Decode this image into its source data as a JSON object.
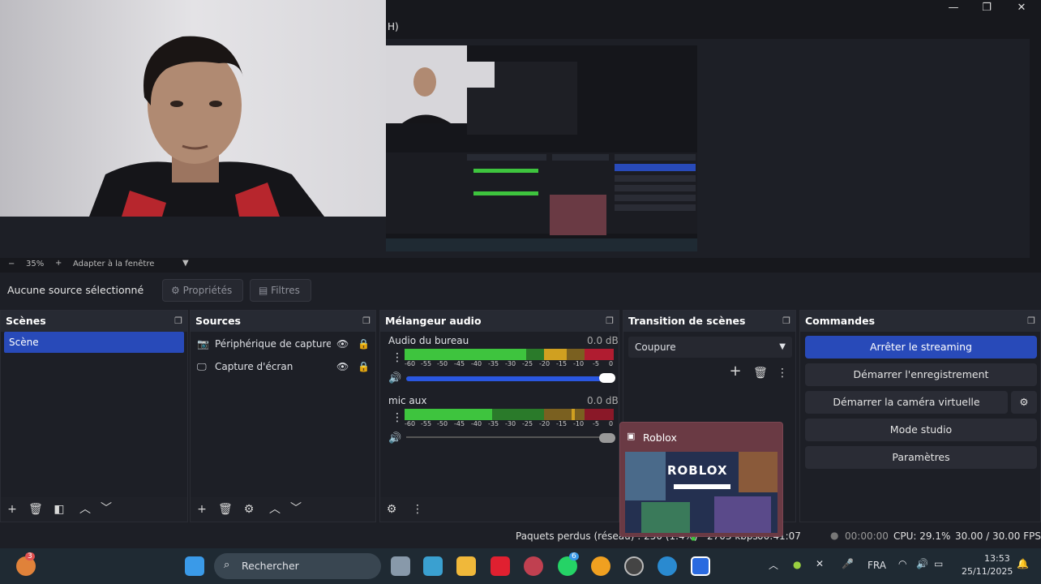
{
  "titlebar": {
    "menu_partial": "H)",
    "minimize": "—",
    "maximize": "❐",
    "close": "✕"
  },
  "zoom": {
    "minus": "−",
    "value": "35%",
    "plus": "+",
    "fit_label": "Adapter à la fenêtre"
  },
  "source_toolbar": {
    "status": "Aucune source sélectionné",
    "properties": "Propriétés",
    "filters": "Filtres"
  },
  "scenes": {
    "title": "Scènes",
    "items": [
      "Scène"
    ]
  },
  "sources": {
    "title": "Sources",
    "items": [
      "Périphérique de capture v",
      "Capture d'écran"
    ]
  },
  "mixer": {
    "title": "Mélangeur audio",
    "channels": [
      {
        "name": "Audio du bureau",
        "db": "0.0 dB"
      },
      {
        "name": "mic aux",
        "db": "0.0 dB"
      }
    ],
    "ticks": [
      "-60",
      "-55",
      "-50",
      "-45",
      "-40",
      "-35",
      "-30",
      "-25",
      "-20",
      "-15",
      "-10",
      "-5",
      "0"
    ]
  },
  "transition": {
    "title": "Transition de scènes",
    "selected": "Coupure"
  },
  "commands": {
    "title": "Commandes",
    "stop_streaming": "Arrêter le streaming",
    "start_recording": "Démarrer l'enregistrement",
    "start_virtual_cam": "Démarrer la caméra virtuelle",
    "studio_mode": "Mode studio",
    "settings": "Paramètres"
  },
  "status": {
    "dropped": "Paquets perdus (réseau) : 250 (1.4%)",
    "bitrate": "2703 kbps",
    "live_time": "00:41:07",
    "rec_time": "00:00:00",
    "cpu": "CPU: 29.1%",
    "fps": "30.00 / 30.00 FPS"
  },
  "roblox_popup": {
    "title": "Roblox",
    "logo_text": "ROBLOX"
  },
  "taskbar": {
    "search_placeholder": "Rechercher",
    "language": "FRA",
    "time": "13:53",
    "date": "25/11/2025",
    "notif_badge": "3",
    "whatsapp_badge": "6"
  },
  "colors": {
    "accent": "#284ab9",
    "meter_green": "#3ec43e",
    "meter_yellow": "#d0a020",
    "meter_red": "#b01c30"
  }
}
